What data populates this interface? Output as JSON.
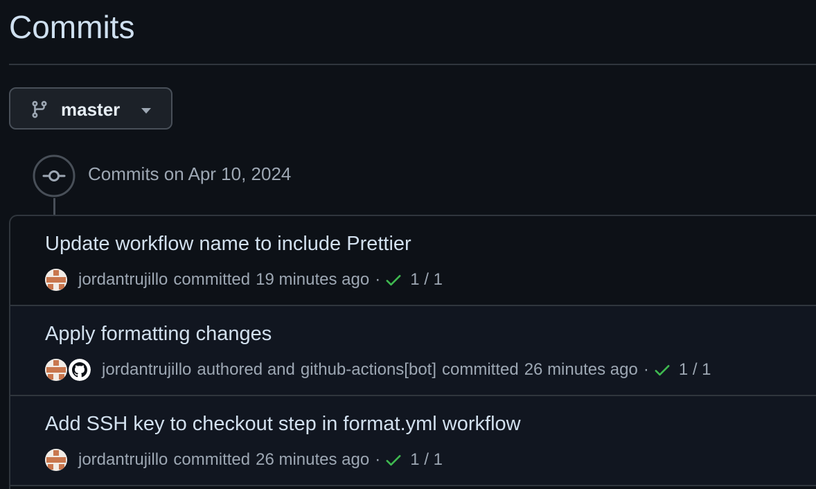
{
  "page": {
    "title": "Commits"
  },
  "branch": {
    "name": "master"
  },
  "timeline": {
    "date_heading": "Commits on Apr 10, 2024"
  },
  "commits": [
    {
      "title": "Update workflow name to include Prettier",
      "author": "jordantrujillo",
      "action": "committed",
      "time": "19 minutes ago",
      "checks": "1 / 1"
    },
    {
      "title": "Apply formatting changes",
      "author": "jordantrujillo",
      "authored_text": "authored and",
      "committer": "github-actions[bot]",
      "action": "committed",
      "time": "26 minutes ago",
      "checks": "1 / 1"
    },
    {
      "title": "Add SSH key to checkout step in format.yml workflow",
      "author": "jordantrujillo",
      "action": "committed",
      "time": "26 minutes ago",
      "checks": "1 / 1"
    }
  ],
  "meta": {
    "separator": "·"
  },
  "colors": {
    "background": "#0d1117",
    "border": "#30363d",
    "check_green": "#3fb950",
    "muted_text": "#9da7b3",
    "avatar_orange": "#c9774e"
  },
  "icons": {
    "branch": "git-branch-icon",
    "caret": "triangle-down-icon",
    "commit": "git-commit-icon",
    "check": "check-icon",
    "bot": "github-mark-icon"
  }
}
